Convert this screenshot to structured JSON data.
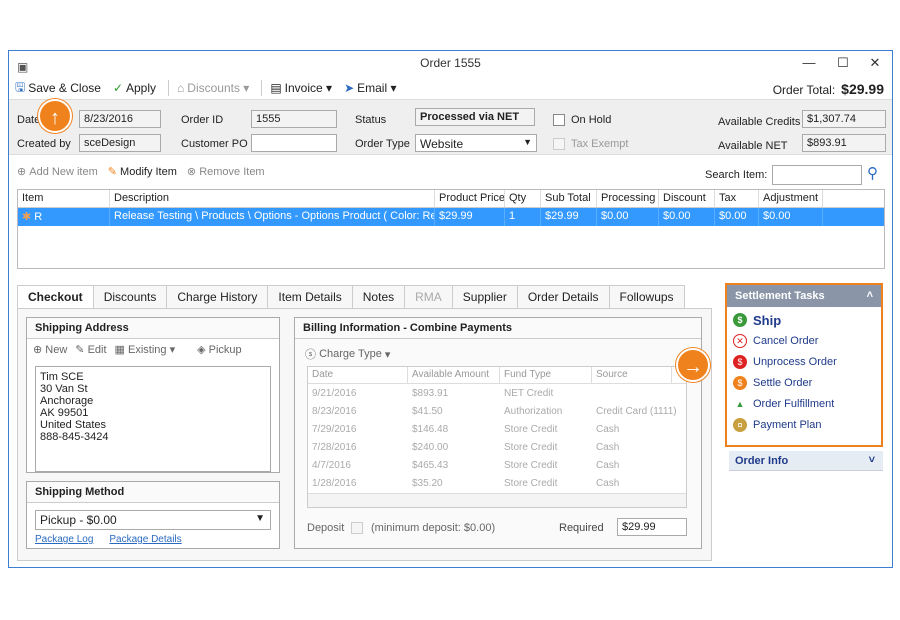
{
  "window": {
    "title": "Order 1555"
  },
  "toolbar": {
    "save_close": "Save & Close",
    "apply": "Apply",
    "discounts": "Discounts",
    "invoice": "Invoice",
    "email": "Email",
    "order_total_label": "Order Total:",
    "order_total_value": "$29.99"
  },
  "header": {
    "date_label": "Date",
    "date_value": "8/23/2016",
    "created_by_label": "Created by",
    "created_by_value": "sceDesign",
    "order_id_label": "Order ID",
    "order_id_value": "1555",
    "customer_po_label": "Customer PO",
    "customer_po_value": "",
    "status_label": "Status",
    "status_value": "Processed via NET",
    "order_type_label": "Order Type",
    "order_type_value": "Website",
    "on_hold_label": "On Hold",
    "tax_exempt_label": "Tax Exempt",
    "available_credits_label": "Available Credits",
    "available_credits_value": "$1,307.74",
    "available_net_label": "Available NET",
    "available_net_value": "$893.91"
  },
  "itembar": {
    "add": "Add New item",
    "modify": "Modify Item",
    "remove": "Remove Item",
    "search_label": "Search Item:"
  },
  "items_grid": {
    "columns": [
      "Item",
      "Description",
      "Product Price",
      "Qty",
      "Sub Total",
      "Processing",
      "Discount",
      "Tax",
      "Adjustment"
    ],
    "rows": [
      [
        "R",
        "Release Testing \\ Products \\ Options - Options Product ( Color: Red)",
        "$29.99",
        "1",
        "$29.99",
        "$0.00",
        "$0.00",
        "$0.00",
        "$0.00"
      ]
    ]
  },
  "tabs": [
    "Checkout",
    "Discounts",
    "Charge History",
    "Item Details",
    "Notes",
    "RMA",
    "Supplier",
    "Order Details",
    "Followups"
  ],
  "shipping_address": {
    "title": "Shipping Address",
    "new": "New",
    "edit": "Edit",
    "existing": "Existing",
    "pickup": "Pickup",
    "lines": [
      "Tim SCE",
      "30 Van St",
      "Anchorage",
      "AK 99501",
      "United States",
      "888-845-3424"
    ]
  },
  "shipping_method": {
    "title": "Shipping Method",
    "value": "Pickup - $0.00",
    "package_log": "Package Log",
    "package_details": "Package Details"
  },
  "billing": {
    "title": "Billing Information - Combine Payments",
    "charge_type": "Charge Type",
    "columns": [
      "Date",
      "Available Amount",
      "Fund Type",
      "Source"
    ],
    "rows": [
      [
        "9/21/2016",
        "$893.91",
        "NET Credit",
        ""
      ],
      [
        "8/23/2016",
        "$41.50",
        "Authorization",
        "Credit Card  (1111)"
      ],
      [
        "7/29/2016",
        "$146.48",
        "Store Credit",
        "Cash"
      ],
      [
        "7/28/2016",
        "$240.00",
        "Store Credit",
        "Cash"
      ],
      [
        "4/7/2016",
        "$465.43",
        "Store Credit",
        "Cash"
      ],
      [
        "1/28/2016",
        "$35.20",
        "Store Credit",
        "Cash"
      ]
    ],
    "deposit_label": "Deposit",
    "min_deposit": "(minimum deposit: $0.00)",
    "required_label": "Required",
    "required_value": "$29.99"
  },
  "settlement": {
    "title": "Settlement Tasks",
    "tasks": [
      "Ship",
      "Cancel Order",
      "Unprocess Order",
      "Settle Order",
      "Order Fulfillment",
      "Payment Plan"
    ],
    "order_info": "Order Info"
  },
  "colors": {
    "accent": "#f0821e",
    "selection": "#3399ff",
    "link": "#2a6ac0"
  }
}
